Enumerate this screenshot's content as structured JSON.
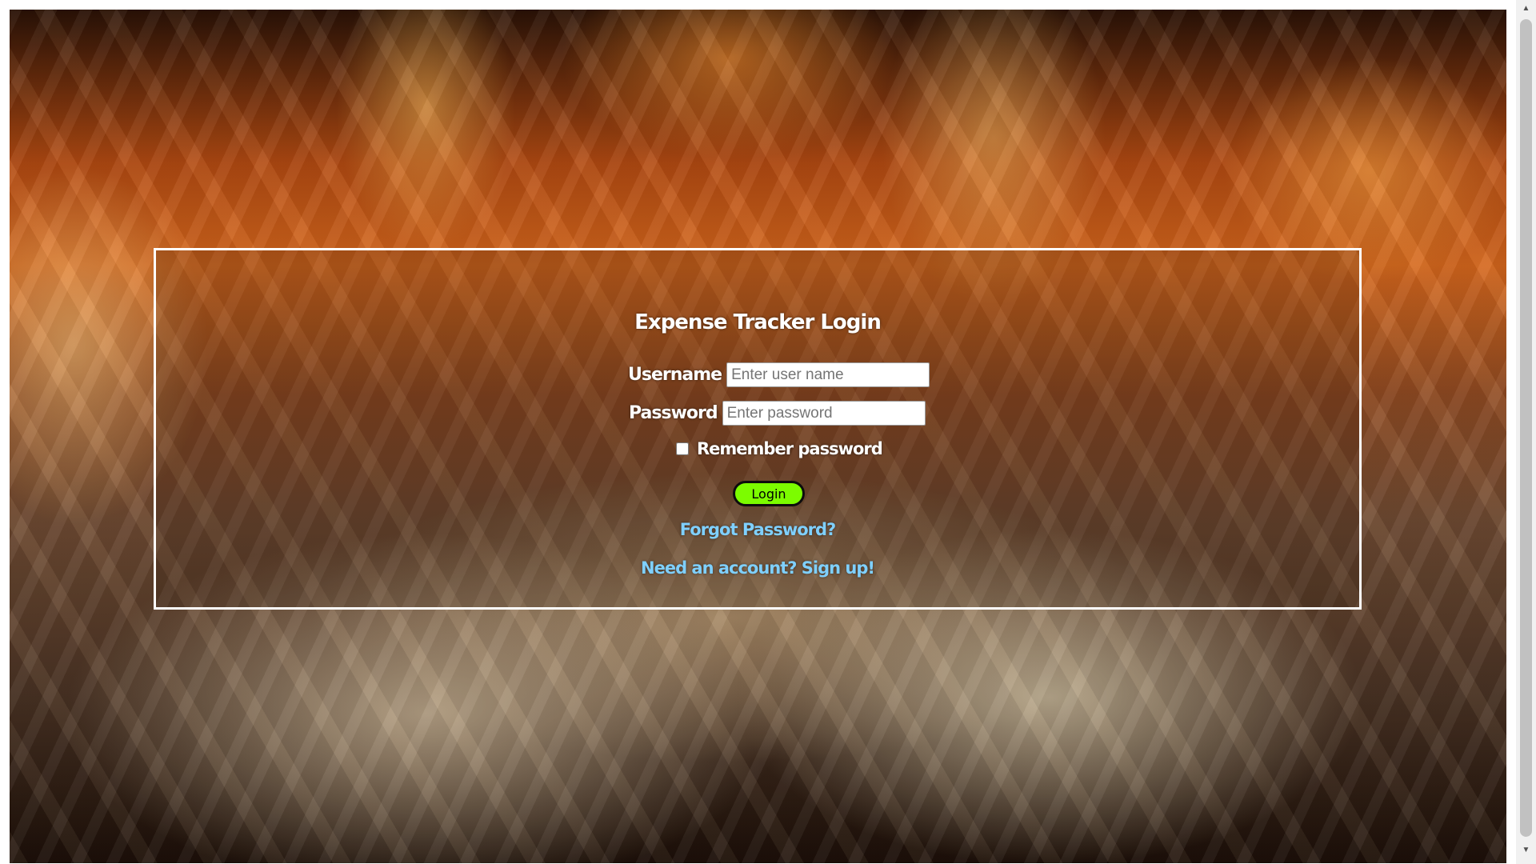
{
  "page": {
    "background_description_icon": "burning-money-background",
    "accent_color": "#7cfc00",
    "link_color": "#7fd0ff"
  },
  "login": {
    "title": "Expense Tracker Login",
    "username_label": "Username",
    "username_placeholder": "Enter user name",
    "username_value": "",
    "password_label": "Password",
    "password_placeholder": "Enter password",
    "password_value": "",
    "remember_label": "Remember password",
    "remember_checked": false,
    "login_button_label": "Login",
    "forgot_link": "Forgot Password?",
    "signup_link": "Need an account? Sign up!"
  },
  "scrollbar": {
    "up_icon": "chevron-up-icon",
    "down_icon": "chevron-down-icon"
  }
}
